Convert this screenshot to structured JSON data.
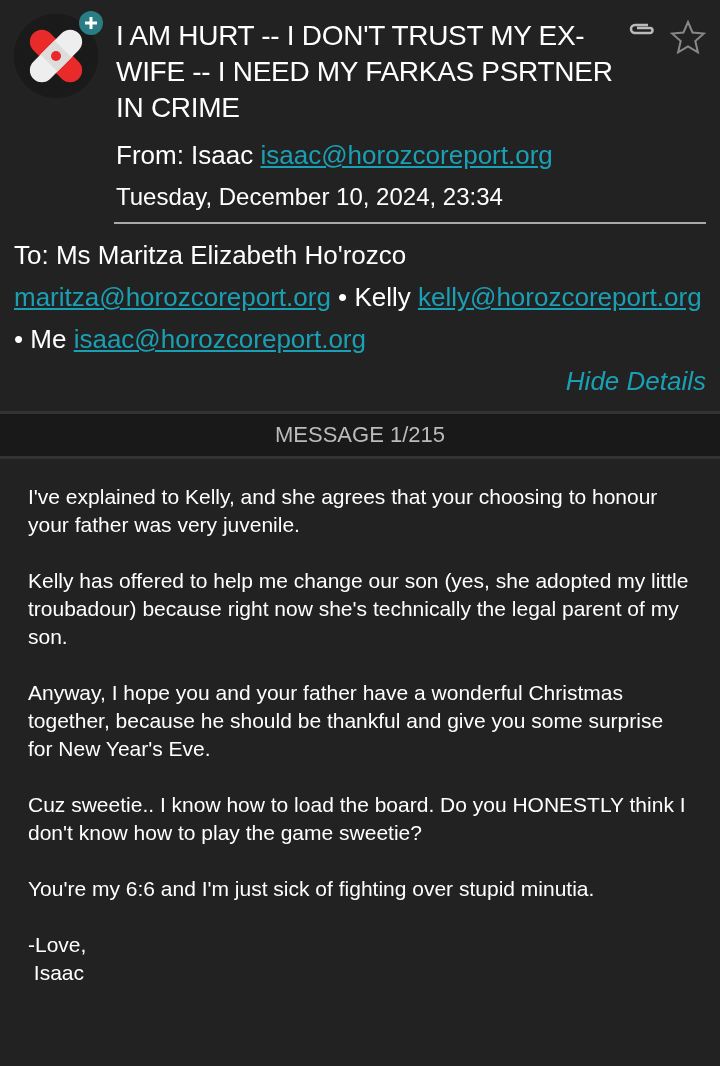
{
  "header": {
    "subject": "I AM HURT -- I DON'T TRUST MY EX-WIFE -- I NEED MY FARKAS PSRTNER IN CRIME",
    "has_attachment": true,
    "starred": false,
    "from": {
      "label": "From:",
      "name": "Isaac",
      "email": "isaac@horozcoreport.org"
    },
    "date": "Tuesday, December 10, 2024, 23:34"
  },
  "recipients": {
    "label": "To:",
    "separator": "•",
    "people": [
      {
        "name": "Ms Maritza Elizabeth Ho'rozco",
        "email": "maritza@horozcoreport.org"
      },
      {
        "name": "Kelly",
        "email": "kelly@horozcoreport.org"
      },
      {
        "name": "Me",
        "email": "isaac@horozcoreport.org"
      }
    ]
  },
  "hide_details": "Hide Details",
  "message_counter": "MESSAGE 1/215",
  "body": [
    "I've explained to Kelly, and she agrees that your choosing to honour your father was very juvenile.",
    "Kelly has offered to help me change our son (yes, she adopted my little troubadour) because right now she's technically the legal parent of my son.",
    "Anyway, I hope you and your father have a wonderful Christmas together, because he should be thankful and give you some surprise for New Year's Eve.",
    "Cuz sweetie.. I know how to load the board. Do you HONESTLY think I don't know how to play the game sweetie?",
    "You're my 6:6 and I'm just sick of fighting over stupid minutia.",
    "-Love,\n Isaac"
  ]
}
